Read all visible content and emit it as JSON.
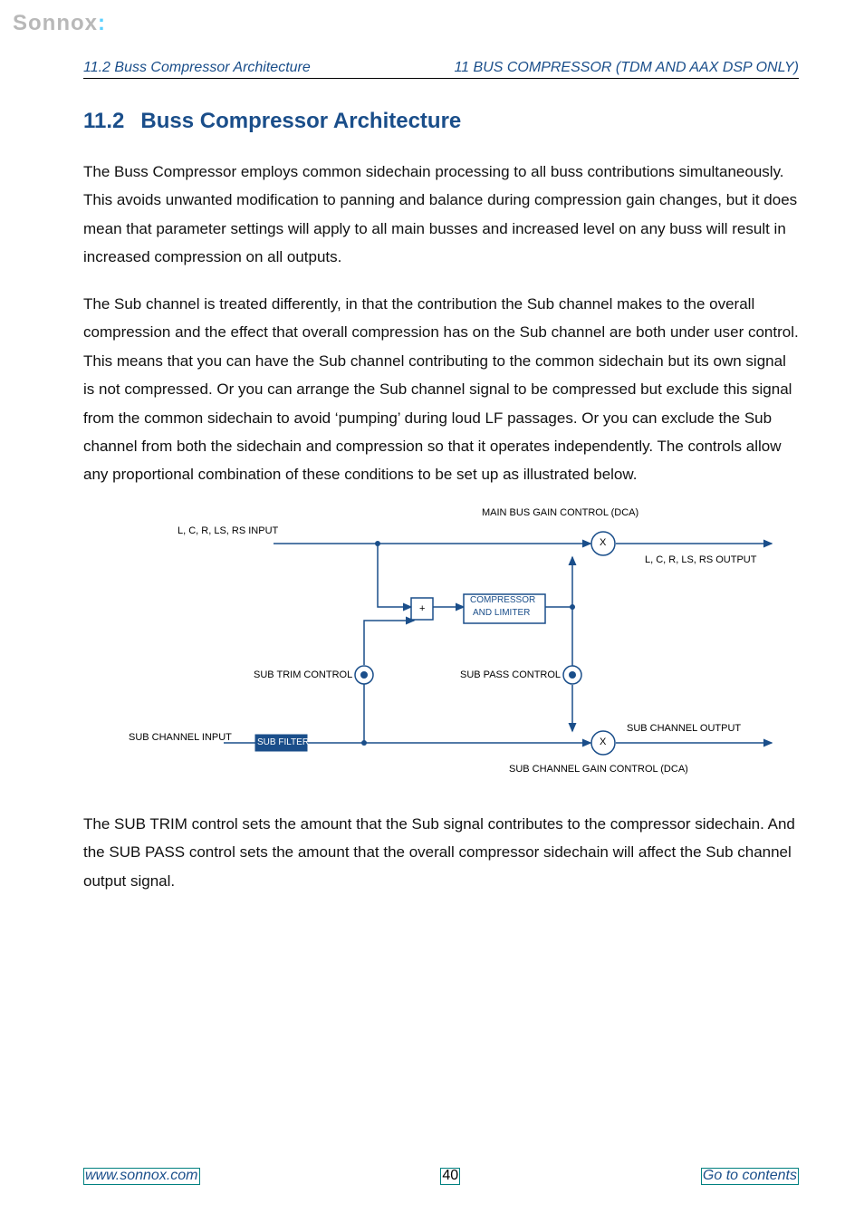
{
  "logo": {
    "text": "Sonnox"
  },
  "running_head": {
    "left": "11.2   Buss Compressor Architecture",
    "right": "11   BUS COMPRESSOR (TDM AND AAX DSP ONLY)"
  },
  "section": {
    "number": "11.2",
    "title": "Buss Compressor Architecture"
  },
  "paragraphs": {
    "p1": "The Buss Compressor employs common sidechain processing to all buss contributions simultaneously. This avoids unwanted modification to panning and balance during compression gain changes, but it does mean that parameter settings will apply to all main busses and increased level on any buss will result in increased compression on all outputs.",
    "p2": "The Sub channel is treated differently, in that the contribution the Sub channel makes to the overall compression and the effect that overall compression has on the Sub channel are both under user control. This means that you can have the Sub channel contributing to the common sidechain but its own signal is not compressed. Or you can arrange the Sub channel signal to be compressed but exclude this signal from the common sidechain to avoid ‘pumping’ during loud LF passages. Or you can exclude the Sub channel from both the sidechain and compression so that it operates independently. The controls allow any proportional combination of these conditions to be set up as illustrated below.",
    "p3": "The SUB TRIM control sets the amount that the Sub signal contributes to the compressor sidechain. And the SUB PASS control sets the amount that the overall compressor sidechain will affect the Sub channel output signal."
  },
  "diagram": {
    "labels": {
      "main_gain": "MAIN BUS GAIN CONTROL (DCA)",
      "main_input": "L, C, R, LS, RS INPUT",
      "main_output": "L, C, R, LS, RS OUTPUT",
      "compressor_l1": "COMPRESSOR",
      "compressor_l2": "AND LIMITER",
      "sub_trim": "SUB TRIM CONTROL",
      "sub_pass": "SUB PASS CONTROL",
      "sub_input": "SUB CHANNEL INPUT",
      "sub_filter": "SUB FILTER",
      "sub_output": "SUB CHANNEL OUTPUT",
      "sub_gain": "SUB CHANNEL GAIN CONTROL (DCA)",
      "plus": "+",
      "x": "X"
    }
  },
  "footer": {
    "left": "www.sonnox.com",
    "page": "40",
    "right": "Go to contents"
  }
}
